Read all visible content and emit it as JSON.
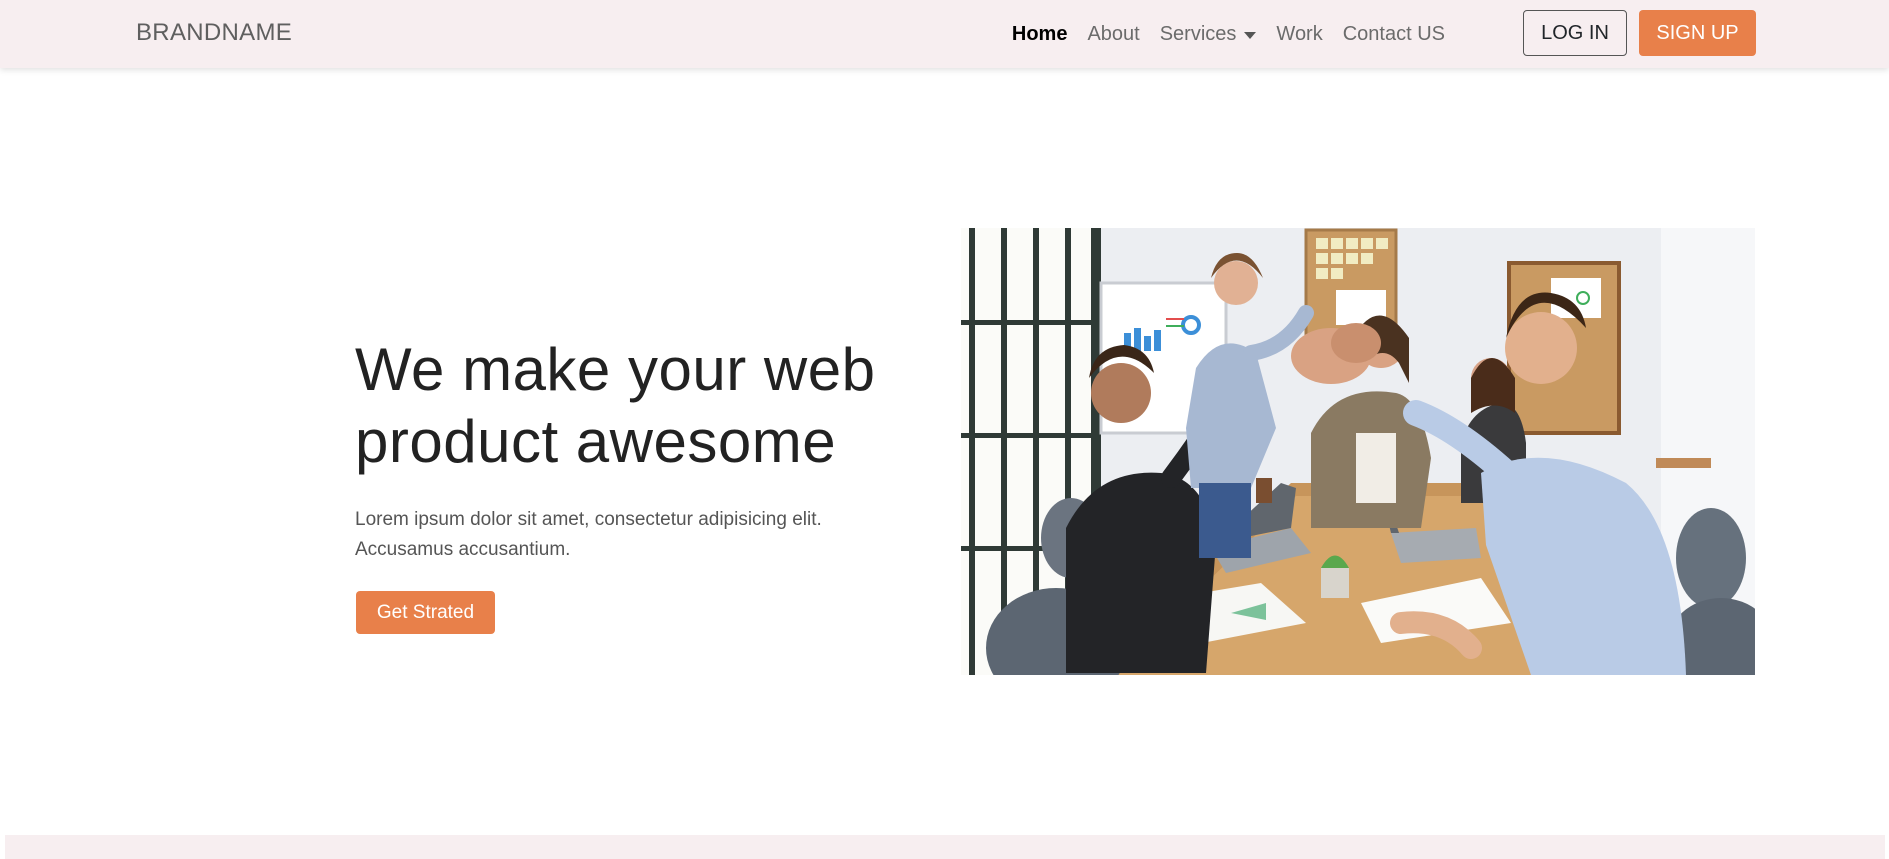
{
  "brand": "BRANDNAME",
  "nav": {
    "links": [
      {
        "label": "Home",
        "active": true
      },
      {
        "label": "About"
      },
      {
        "label": "Services",
        "dropdown": true
      },
      {
        "label": "Work"
      },
      {
        "label": "Contact US"
      }
    ],
    "login_label": "LOG IN",
    "signup_label": "SIGN UP"
  },
  "hero": {
    "title_line1": "We make your web",
    "title_line2": "product awesome",
    "text_line1": "Lorem ipsum dolor sit amet, consectetur adipisicing elit.",
    "text_line2": "Accusamus accusantium.",
    "cta_label": "Get Strated"
  },
  "colors": {
    "accent": "#e8804a",
    "navbar_bg": "#f7eef0"
  },
  "icons": {
    "dropdown": "chevron-down-icon"
  }
}
